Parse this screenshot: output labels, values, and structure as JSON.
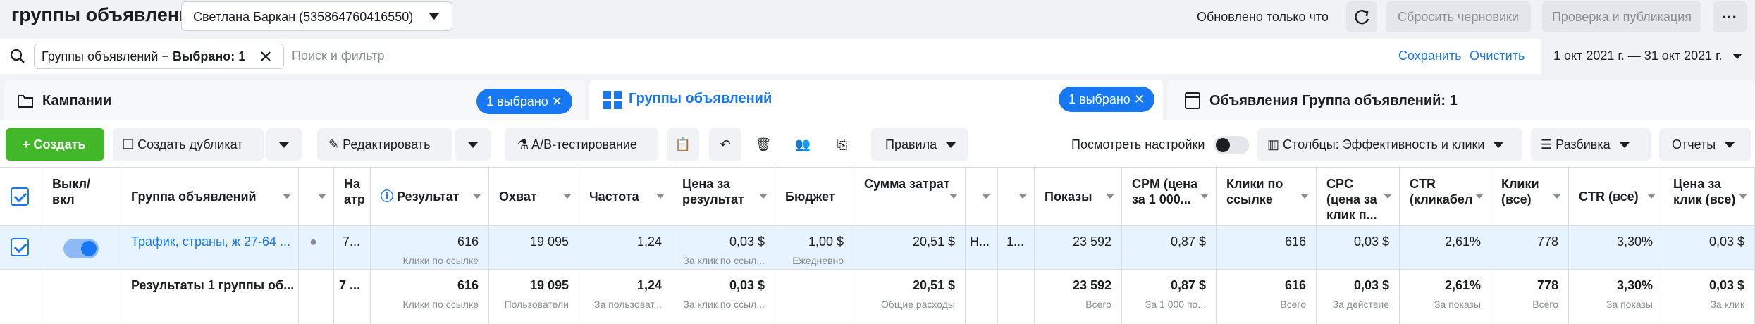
{
  "header": {
    "title": "группы объявлений",
    "account": "Светлана Баркан (535864760416550)",
    "updated_text": "Обновлено только что",
    "discard_label": "Сбросить черновики",
    "review_label": "Проверка и публикация"
  },
  "filter": {
    "chip_prefix": "Группы объявлений − ",
    "chip_value": "Выбрано: 1",
    "placeholder": "Поиск и фильтр",
    "save_label": "Сохранить",
    "clear_label": "Очистить",
    "date_range": "1 окт 2021 г. — 31 окт 2021 г."
  },
  "tabs": {
    "campaigns": {
      "label": "Кампании",
      "badge": "1 выбрано"
    },
    "adsets": {
      "label": "Группы объявлений",
      "badge": "1 выбрано"
    },
    "ads": {
      "label": "Объявления Группа объявлений: 1"
    }
  },
  "toolbar": {
    "create": "Создать",
    "duplicate": "Создать дубликат",
    "edit": "Редактировать",
    "ab_test": "A/B-тестирование",
    "rules": "Правила",
    "view_settings": "Посмотреть настройки",
    "columns": "Столбцы: Эффективность и клики",
    "breakdown": "Разбивка",
    "reports": "Отчеты"
  },
  "table": {
    "headers": {
      "toggle": "Выкл/вкл",
      "name": "Группа объявлений",
      "delivery": "На атр",
      "result": "Результат",
      "reach": "Охват",
      "frequency": "Частота",
      "cost_per_result": "Цена за результат",
      "budget": "Бюджет",
      "amount_spent": "Сумма затрат",
      "impressions": "Показы",
      "cpm": "CPM (цена за 1 000...",
      "link_clicks": "Клики по ссылке",
      "cpc": "CPC (цена за клик п...",
      "ctr": "CTR (кликабел",
      "clicks_all": "Клики (все)",
      "ctr_all": "CTR (все)",
      "cpc_all": "Цена за клик (все)"
    },
    "row": {
      "name": "Трафик, страны, ж 27-64 ...",
      "delivery": "7...",
      "result": "616",
      "result_sub": "Клики по ссылке",
      "reach": "19 095",
      "frequency": "1,24",
      "cost_per_result": "0,03 $",
      "cost_per_result_sub": "За клик по ссыл...",
      "budget": "1,00 $",
      "budget_sub": "Ежедневно",
      "amount_spent": "20,51 $",
      "col_h": "Н...",
      "col_i": "1...",
      "impressions": "23 592",
      "cpm": "0,87 $",
      "link_clicks": "616",
      "cpc": "0,03 $",
      "ctr": "2,61%",
      "clicks_all": "778",
      "ctr_all": "3,30%",
      "cpc_all": "0,03 $"
    },
    "totals": {
      "name": "Результаты 1 группы об...",
      "delivery": "7 ...",
      "result": "616",
      "result_sub": "Клики по ссылке",
      "reach": "19 095",
      "reach_sub": "Пользователи",
      "frequency": "1,24",
      "frequency_sub": "За пользоват...",
      "cost_per_result": "0,03 $",
      "cost_per_result_sub": "За клик по ссыл...",
      "amount_spent": "20,51 $",
      "amount_spent_sub": "Общие расходы",
      "impressions": "23 592",
      "impressions_sub": "Всего",
      "cpm": "0,87 $",
      "cpm_sub": "За 1 000 по...",
      "link_clicks": "616",
      "link_clicks_sub": "Всего",
      "cpc": "0,03 $",
      "cpc_sub": "За действие",
      "ctr": "2,61%",
      "ctr_sub": "За показы",
      "clicks_all": "778",
      "clicks_all_sub": "Всего",
      "ctr_all": "3,30%",
      "ctr_all_sub": "За показы",
      "cpc_all": "0,03 $",
      "cpc_all_sub": "За клик"
    }
  },
  "colors": {
    "accent": "#1877f2",
    "create_green": "#42b72a",
    "selected_row": "#e7f3ff"
  }
}
